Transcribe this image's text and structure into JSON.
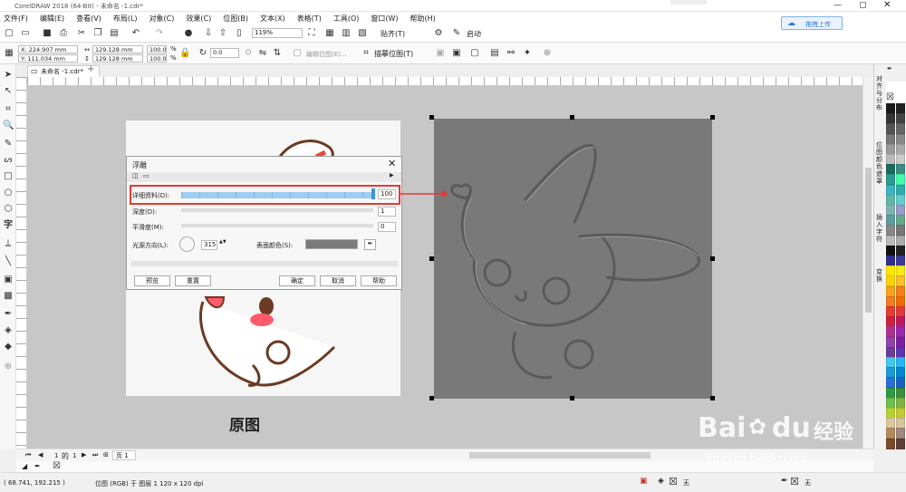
{
  "window": {
    "title": "CorelDRAW 2018 (64-Bit) - 未命名 -1.cdr*"
  },
  "menu": [
    "文件(F)",
    "编辑(E)",
    "查看(V)",
    "布局(L)",
    "对象(C)",
    "效果(C)",
    "位图(B)",
    "文本(X)",
    "表格(T)",
    "工具(O)",
    "窗口(W)",
    "帮助(H)"
  ],
  "toolbar1": {
    "zoom": "119%",
    "snap": "贴齐(T)",
    "launch": "启动",
    "upload": "拖拽上传"
  },
  "toolbar2": {
    "x": "X: 224.907 mm",
    "y": "Y: 111.034 mm",
    "w": "129.128 mm",
    "h": "129.128 mm",
    "sw": "100.0",
    "sh": "100.0",
    "pct": "%",
    "angle": "0.0",
    "edit_bitmap": "编辑位图(E)...",
    "trace_bitmap": "描摹位图(T)"
  },
  "tab": {
    "label": "未命名 -1.cdr*"
  },
  "dialog": {
    "title": "浮雕",
    "detail_label": "详细资料(D):",
    "detail_value": "100",
    "depth_label": "深度(D):",
    "depth_value": "1",
    "smooth_label": "平滑度(M):",
    "smooth_value": "0",
    "light_label": "光源方向(L):",
    "light_value": "315",
    "color_label": "表面颜色(S):",
    "preview": "预览",
    "reset": "重置",
    "ok": "确定",
    "cancel": "取消",
    "help": "帮助"
  },
  "caption": "原图",
  "docker_tabs": [
    "对齐与分布",
    "位图颜色遮罩",
    "插入字符",
    "变换"
  ],
  "pages": {
    "current": "1",
    "of": "的",
    "total": "1",
    "page_tab": "页 1"
  },
  "status": {
    "coords": "( 68.741, 192.215 )",
    "object": "位图 (RGB) 于 图层 1 120 x 120 dpi",
    "fill": "无",
    "outline": "无"
  },
  "watermark": {
    "brand": "Bai",
    "brand2": "du",
    "cn": "经验",
    "url": "jingyan.baidu.com"
  },
  "colors": {
    "highlight": "#e53935",
    "slider_blue": "#7ab8e6",
    "canvas": "#c7c7c7",
    "embossed": "#797979"
  }
}
